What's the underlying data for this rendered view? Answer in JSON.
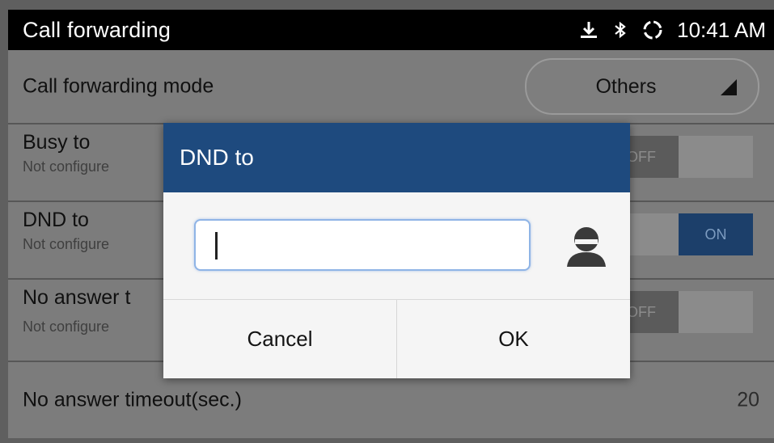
{
  "status_bar": {
    "title": "Call forwarding",
    "time": "10:41 AM",
    "icons": [
      "download-icon",
      "bluetooth-icon",
      "sync-icon"
    ]
  },
  "settings": {
    "mode": {
      "label": "Call forwarding mode",
      "value": "Others"
    },
    "busy_to": {
      "label": "Busy to",
      "sub": "Not configure",
      "toggle": "OFF"
    },
    "dnd_to": {
      "label": "DND to",
      "sub": "Not configure",
      "toggle": "ON"
    },
    "no_answer": {
      "label": "No answer t",
      "sub": "Not configure",
      "toggle": "OFF"
    },
    "timeout": {
      "label": "No answer timeout(sec.)",
      "value": "20"
    }
  },
  "dialog": {
    "title": "DND to",
    "input_value": "",
    "cancel_label": "Cancel",
    "ok_label": "OK"
  },
  "colors": {
    "dialog_header": "#1e4a7e",
    "toggle_on": "#1c3f6a",
    "input_focus": "#8fb4e6"
  }
}
